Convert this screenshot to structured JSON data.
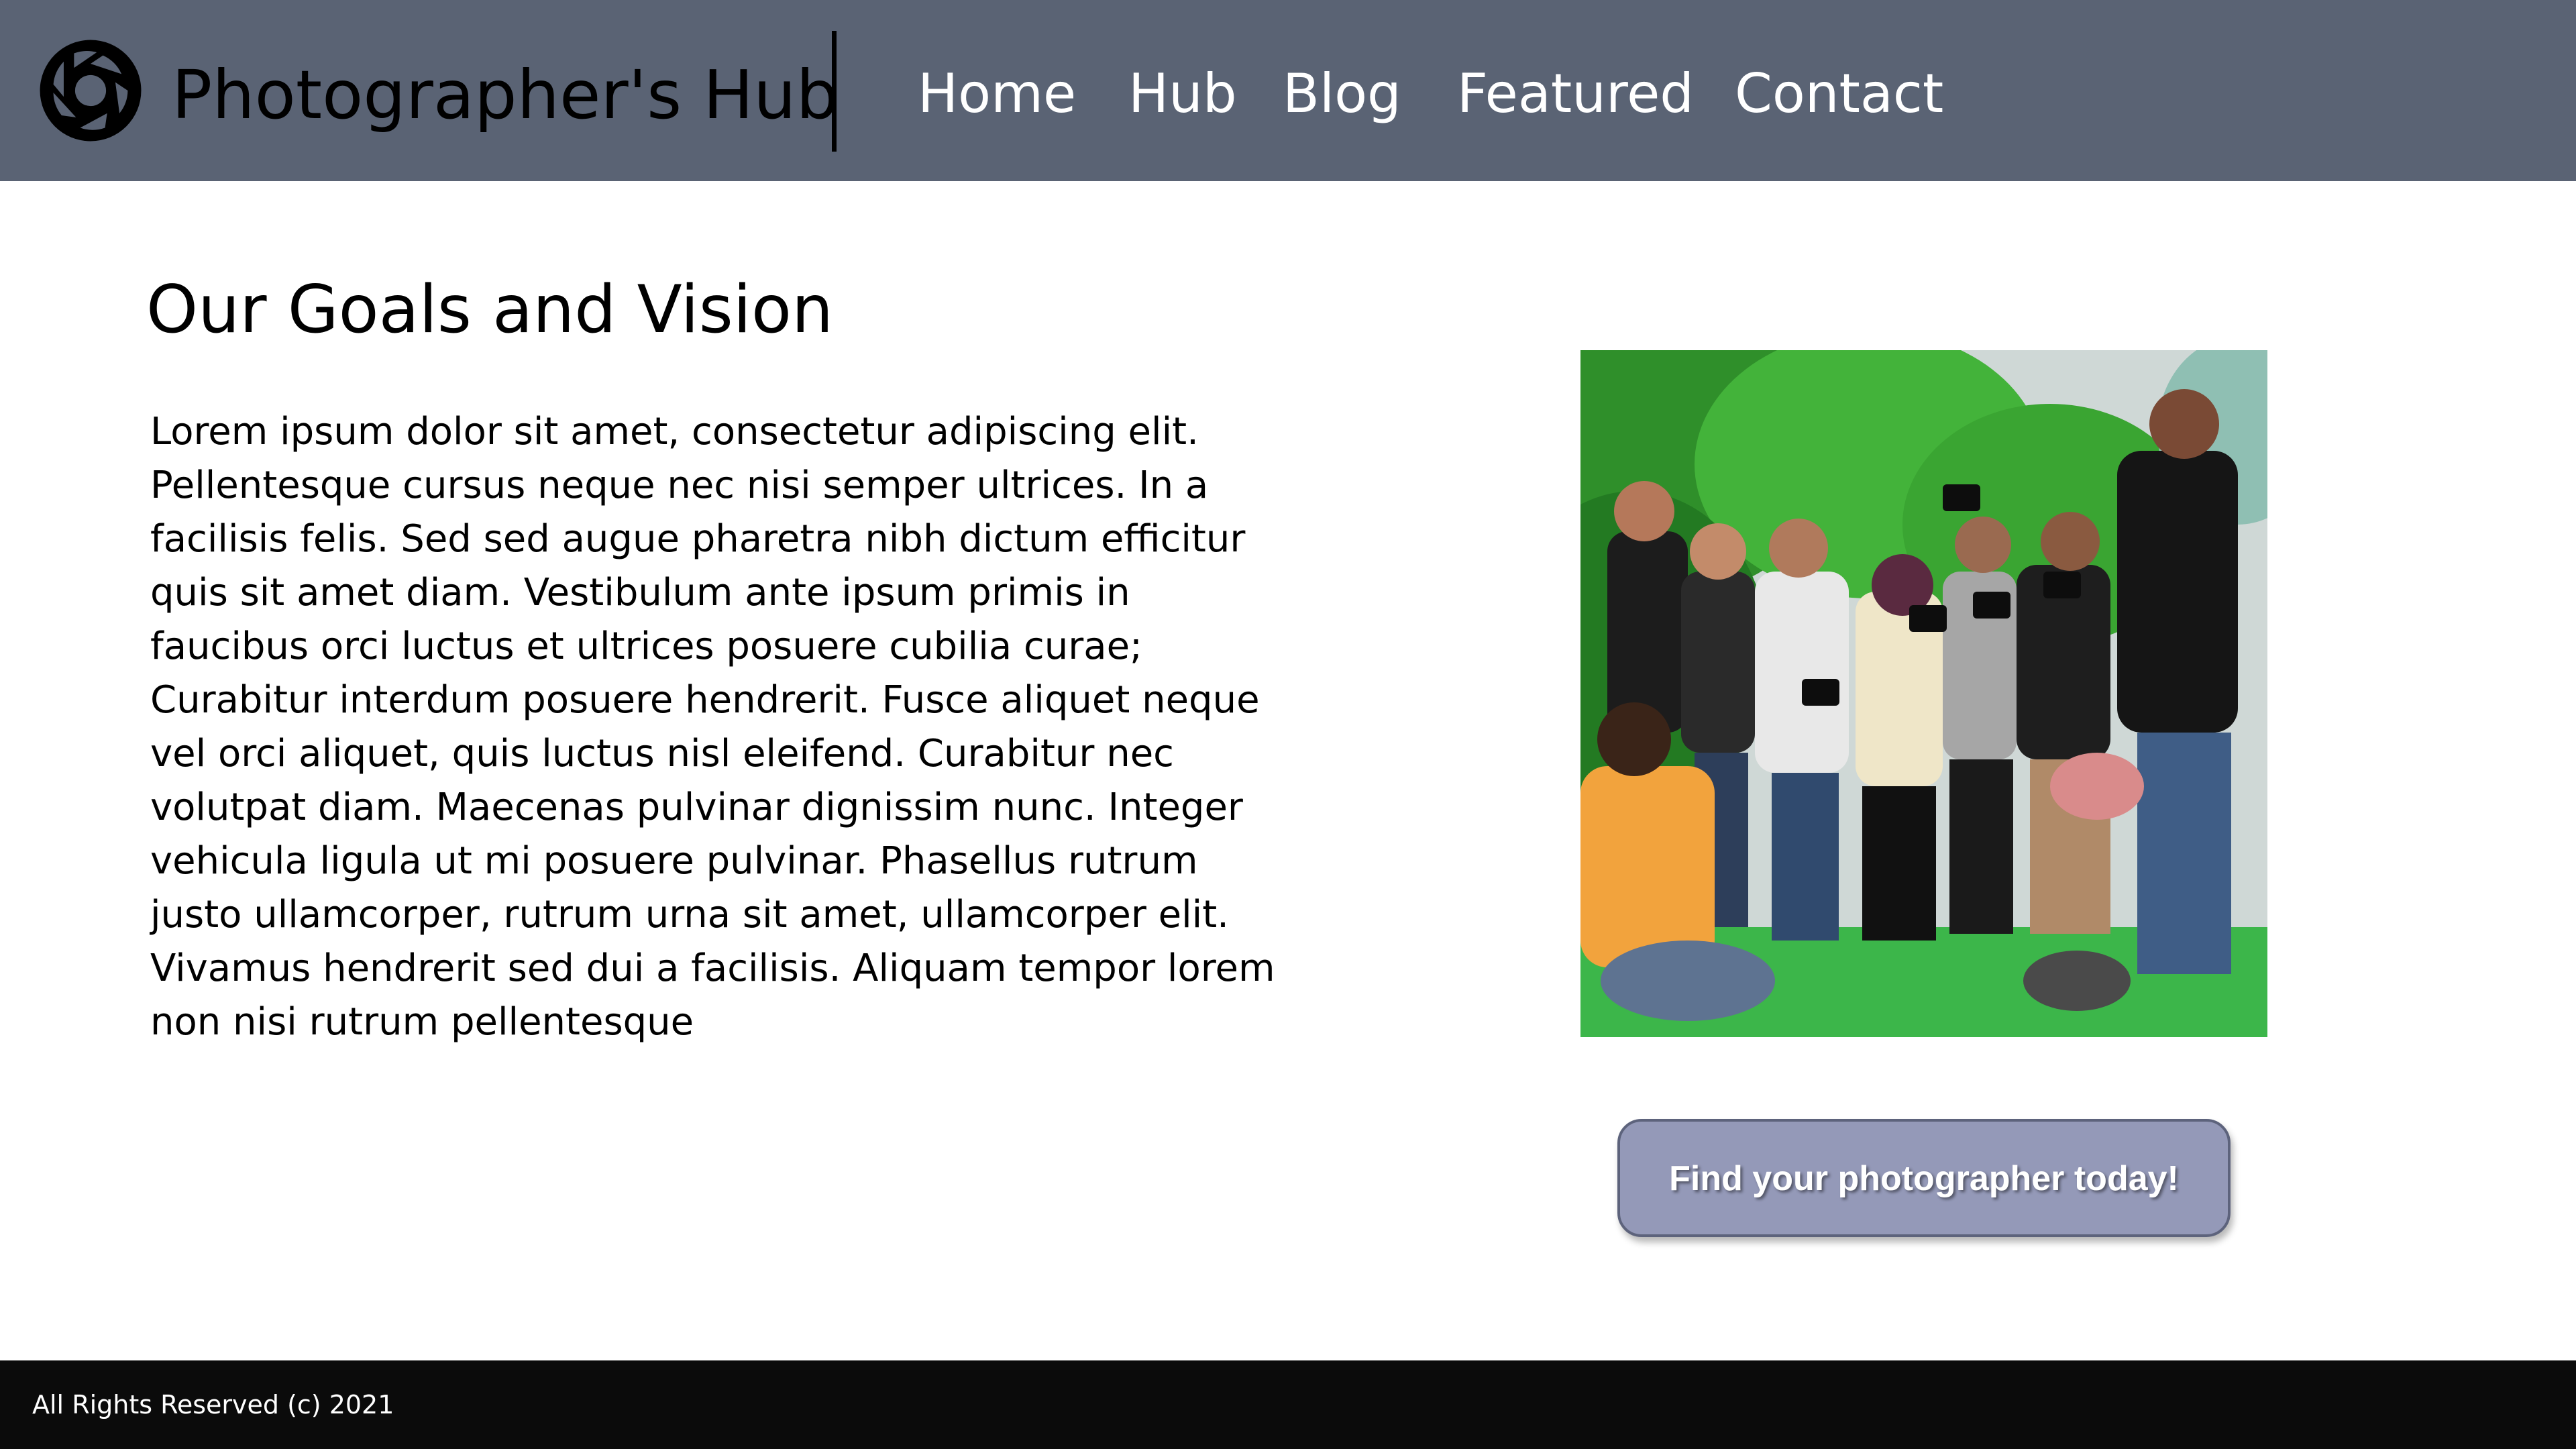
{
  "header": {
    "logo_icon": "camera-aperture-icon",
    "brand": "Photographer's Hub",
    "background_color": "#5a6374",
    "nav": [
      {
        "label": "Home"
      },
      {
        "label": "Hub"
      },
      {
        "label": "Blog"
      },
      {
        "label": "Featured"
      },
      {
        "label": "Contact"
      }
    ]
  },
  "main": {
    "heading": "Our Goals and Vision",
    "paragraph": "Lorem ipsum dolor sit amet, consectetur adipiscing elit. Pellentesque cursus neque nec nisi semper ultrices. In a facilisis felis. Sed sed augue pharetra nibh dictum efficitur quis sit amet diam. Vestibulum ante ipsum primis in faucibus orci luctus et ultrices posuere cubilia curae; Curabitur interdum posuere hendrerit. Fusce aliquet neque vel orci aliquet, quis luctus nisl eleifend. Curabitur nec volutpat diam. Maecenas pulvinar dignissim nunc. Integer vehicula ligula ut mi posuere pulvinar. Phasellus rutrum justo ullamcorper, rutrum urna sit amet, ullamcorper elit. Vivamus hendrerit sed dui a facilisis. Aliquam tempor lorem non nisi rutrum pellentesque",
    "photo_subject": "group of photographers with cameras outdoors among greenery",
    "cta_label": "Find your photographer today!",
    "cta_color": "#9499b8"
  },
  "footer": {
    "text": "All Rights Reserved (c) 2021",
    "background_color": "#0b0b0b"
  }
}
